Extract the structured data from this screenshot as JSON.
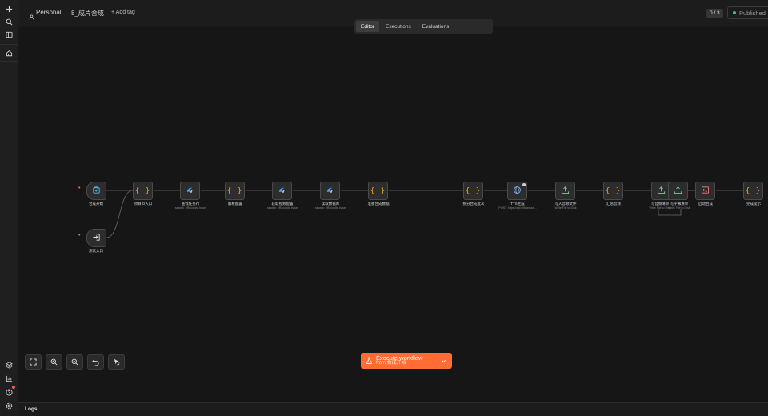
{
  "header": {
    "project": "Personal",
    "workflow_name": "8_成片合成",
    "add_tag": "+ Add tag",
    "tabs": [
      {
        "label": "Editor",
        "active": true
      },
      {
        "label": "Executions",
        "active": false
      },
      {
        "label": "Evaluations",
        "active": false
      }
    ],
    "version_counter": "0 / 3",
    "status": "Published"
  },
  "rail": {
    "icons": [
      "plus-icon",
      "search-icon",
      "sidebar-toggle-icon",
      "home-icon",
      "templates-icon",
      "insights-icon",
      "help-icon",
      "settings-icon"
    ]
  },
  "workflow": {
    "nodes": [
      {
        "id": "n1",
        "label": "合成开始",
        "sub": "",
        "icon": "trigger-icon",
        "trigger": true
      },
      {
        "id": "n2",
        "label": "测试入口",
        "sub": "",
        "icon": "execute-icon",
        "trigger": true
      },
      {
        "id": "n3",
        "label": "项目ID入口",
        "sub": "",
        "icon": "code-braces-icon"
      },
      {
        "id": "n4",
        "label": "查找任务行",
        "sub": "search: nRecords: base",
        "icon": "baserow-icon"
      },
      {
        "id": "n5",
        "label": "解析配置",
        "sub": "",
        "icon": "code-braces-icon"
      },
      {
        "id": "n6",
        "label": "获取视频配置",
        "sub": "search: nRecords: base",
        "icon": "baserow-icon"
      },
      {
        "id": "n7",
        "label": "读取数据库",
        "sub": "search: nRecords: base",
        "icon": "baserow-icon"
      },
      {
        "id": "n8",
        "label": "准备合成数据",
        "sub": "",
        "icon": "code-braces-icon"
      },
      {
        "id": "n9",
        "label": "拆分合成批次",
        "sub": "",
        "icon": "code-braces-icon"
      },
      {
        "id": "n10",
        "label": "TTS生成",
        "sub": "POST: https://api.siliconflow...",
        "icon": "globe-icon"
      },
      {
        "id": "n11",
        "label": "写入音频文件",
        "sub": "Write File to Disk",
        "icon": "write-file-icon"
      },
      {
        "id": "n12",
        "label": "汇总音频",
        "sub": "",
        "icon": "code-braces-icon"
      },
      {
        "id": "n13",
        "label": "写音频清单",
        "sub": "Write File to Disk",
        "icon": "write-file-icon"
      },
      {
        "id": "n14",
        "label": "写字幕清单",
        "sub": "Write File to Disk",
        "icon": "write-file-icon"
      },
      {
        "id": "n15",
        "label": "启动合成",
        "sub": "",
        "icon": "terminal-icon"
      },
      {
        "id": "n16",
        "label": "完成提示",
        "sub": "",
        "icon": "code-braces-icon"
      }
    ]
  },
  "controls": {
    "fit_view": "fit-view-icon",
    "zoom_in": "zoom-in-icon",
    "zoom_out": "zoom-out-icon",
    "undo": "undo-icon",
    "tidy_up": "tidy-up-icon"
  },
  "execute": {
    "title": "Execute workflow",
    "subtitle": "from 合成开始"
  },
  "logs": {
    "label": "Logs"
  },
  "colors": {
    "accent": "#ff6d35",
    "code": "#f5a623",
    "baserow": "#3aa0ff",
    "write_file": "#6fd08c",
    "terminal": "#ff7a7a",
    "published_dot": "#3ec27a"
  }
}
